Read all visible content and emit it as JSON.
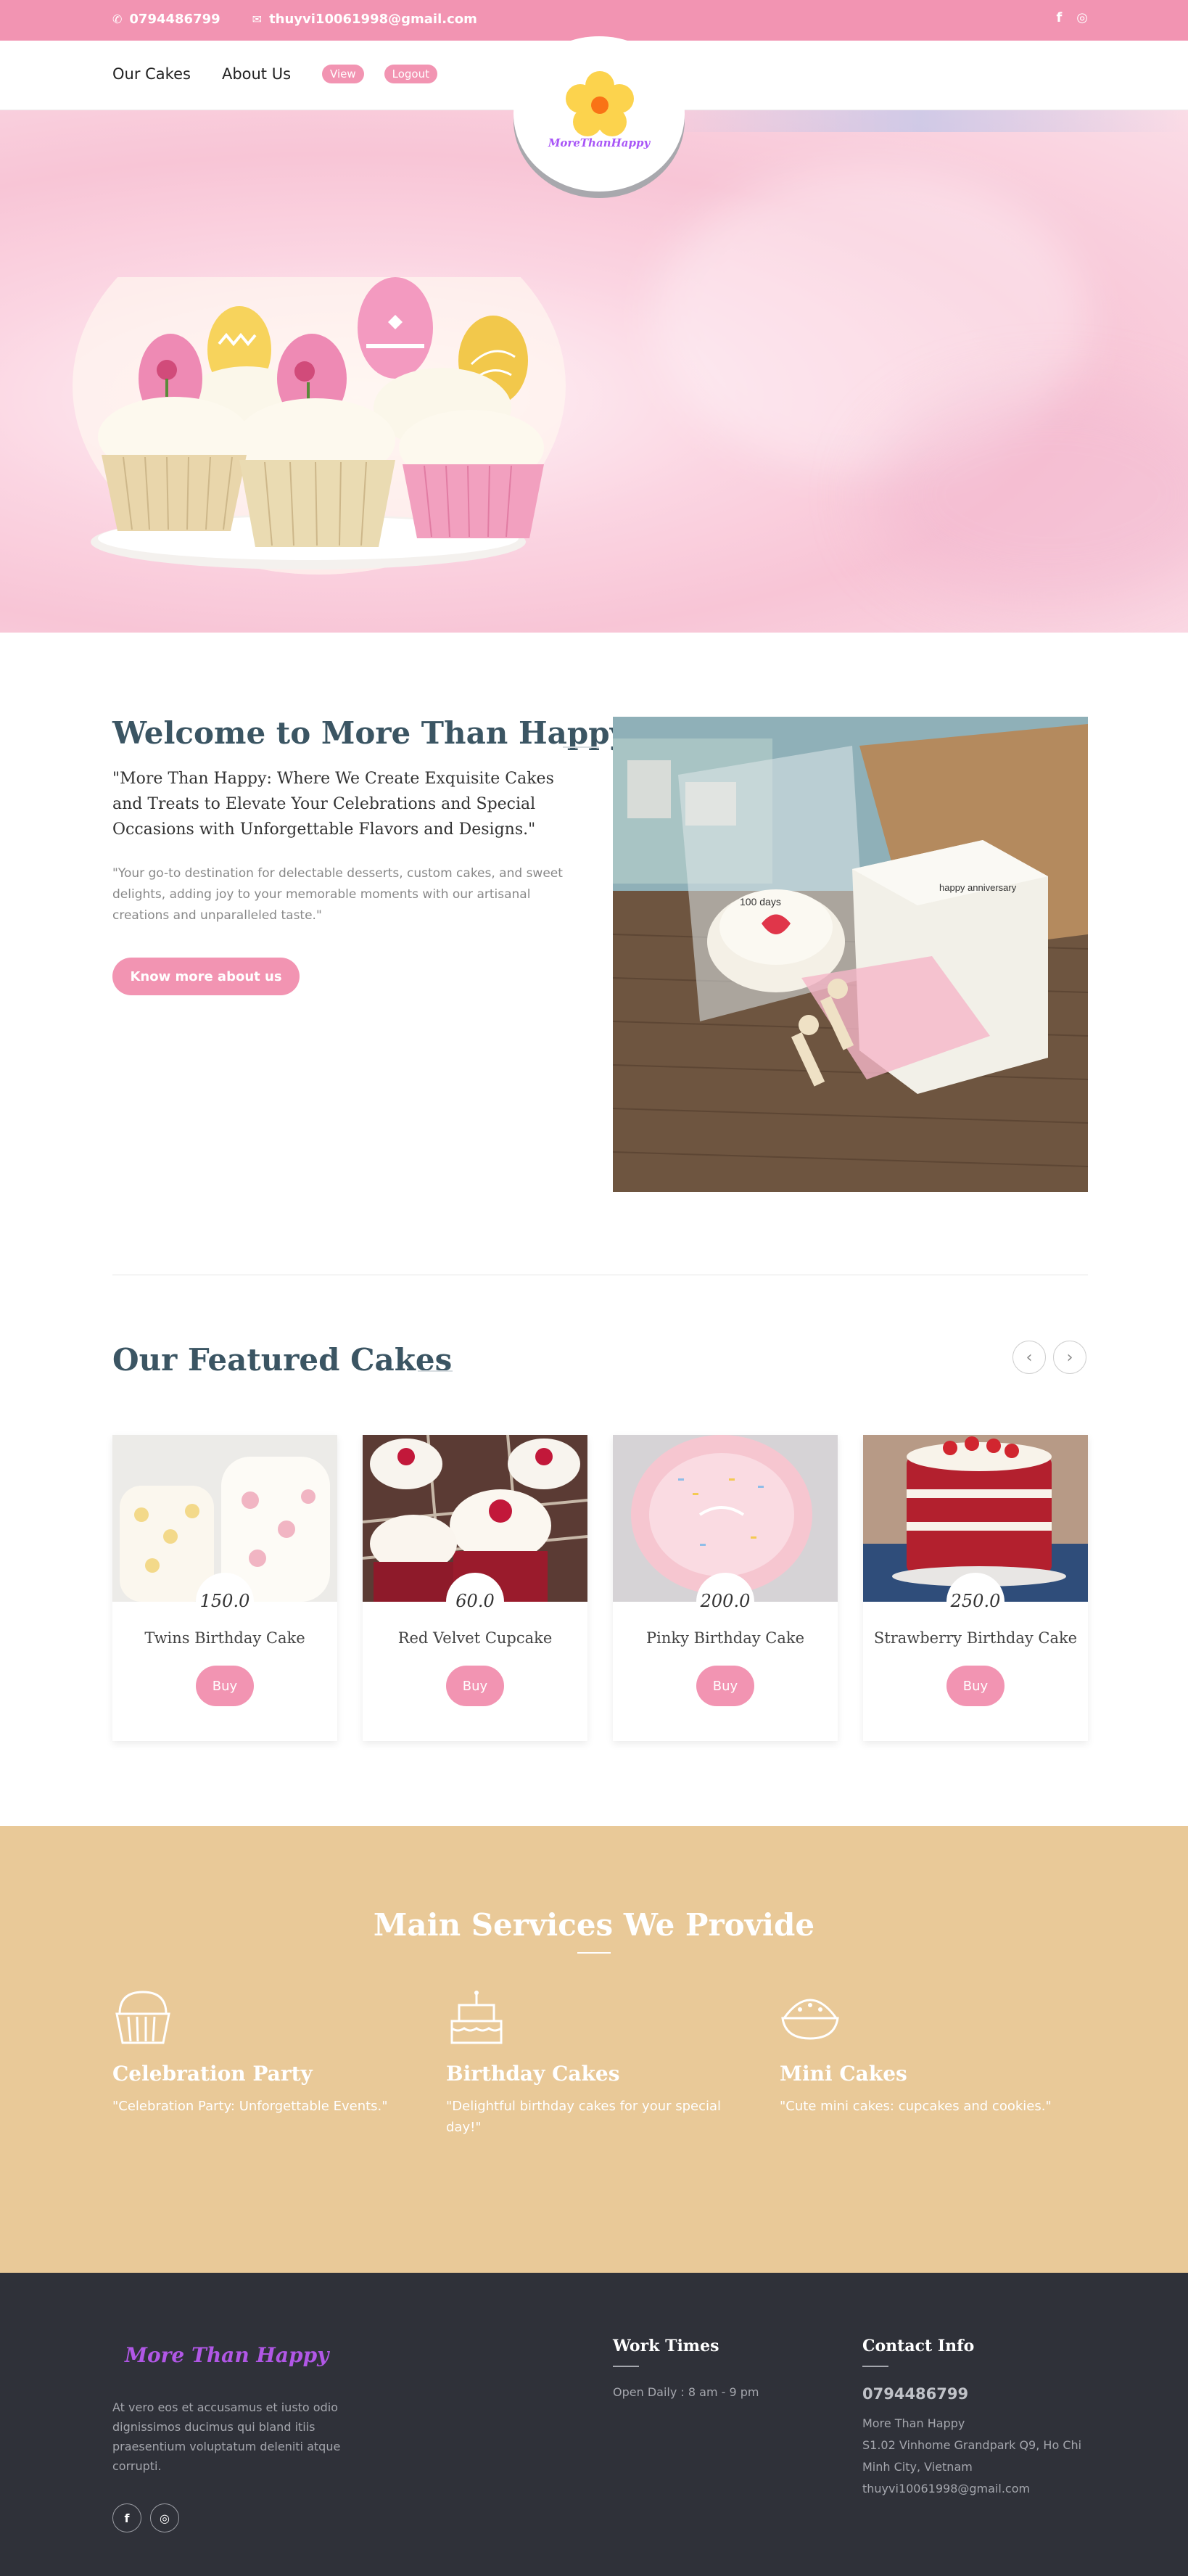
{
  "topbar": {
    "phone": "0794486799",
    "email": "thuyvi10061998@gmail.com",
    "social": [
      "f",
      "◎"
    ],
    "icons": [
      "phone-icon",
      "envelope-icon",
      "facebook-icon",
      "instagram-icon"
    ]
  },
  "nav": {
    "items": [
      "Our Cakes",
      "About Us"
    ],
    "view_label": "View",
    "logout_label": "Logout"
  },
  "logo": {
    "text": "MoreThanHappy"
  },
  "welcome": {
    "title": "Welcome to More Than Happy",
    "quote": "\"More Than Happy: Where We Create Exquisite Cakes and Treats to Elevate Your Celebrations and Special Occasions with Unforgettable Flavors and Designs.\"",
    "sub": "\"Your go-to destination for delectable desserts, custom cakes, and sweet delights, adding joy to your memorable moments with our artisanal creations and unparalleled taste.\"",
    "button": "Know more about us",
    "photo_text_1": "happy anniversary",
    "photo_text_2": "100 days"
  },
  "featured": {
    "title": "Our Featured Cakes",
    "prev": "‹",
    "next": "›",
    "cards": [
      {
        "price": "150.0",
        "name": "Twins Birthday Cake",
        "buy": "Buy"
      },
      {
        "price": "60.0",
        "name": "Red Velvet Cupcake",
        "buy": "Buy"
      },
      {
        "price": "200.0",
        "name": "Pinky Birthday Cake",
        "buy": "Buy"
      },
      {
        "price": "250.0",
        "name": "Strawberry Birthday Cake",
        "buy": "Buy"
      }
    ]
  },
  "services": {
    "title": "Main Services We Provide",
    "items": [
      {
        "name": "Celebration Party",
        "desc": "\"Celebration Party: Unforgettable Events.\"",
        "icon": "cupcake-icon"
      },
      {
        "name": "Birthday Cakes",
        "desc": "\"Delightful birthday cakes for your special day!\"",
        "icon": "birthday-cake-icon"
      },
      {
        "name": "Mini Cakes",
        "desc": "\"Cute mini cakes: cupcakes and cookies.\"",
        "icon": "pie-icon"
      }
    ]
  },
  "footer": {
    "logo": "More Than Happy",
    "desc": "At vero eos et accusamus et iusto odio dignissimos ducimus qui bland itiis praesentium voluptatum deleniti atque corrupti.",
    "work_title": "Work Times",
    "work_text": "Open Daily : 8 am - 9 pm",
    "contact_title": "Contact Info",
    "phone": "0794486799",
    "name": "More Than Happy",
    "address": "S1.02 Vinhome Grandpark Q9, Ho Chi Minh City, Vietnam",
    "email": "thuyvi10061998@gmail.com"
  },
  "colors": {
    "accent": "#f294b2",
    "heading": "#3b5563",
    "services_bg": "#e9c998",
    "footer_bg": "#2f3139",
    "logo_purple": "#b157e6"
  }
}
